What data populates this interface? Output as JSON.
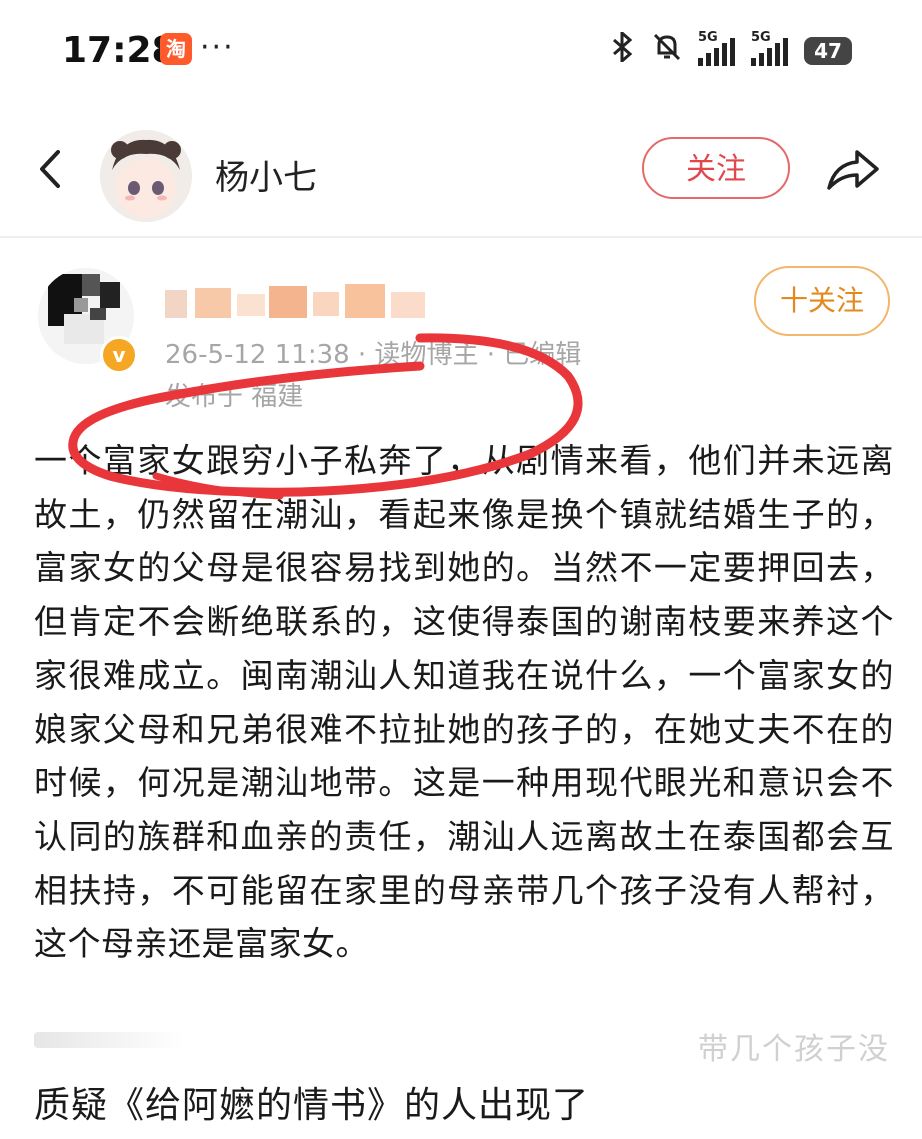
{
  "status_bar": {
    "time": "17:28",
    "app_badge": "淘",
    "more": "···",
    "network_1": "5G",
    "network_2": "5G",
    "battery": "47"
  },
  "header": {
    "author_name": "杨小七",
    "follow_label": "关注"
  },
  "post": {
    "meta": "26-5-12 11:38 · 读物博主 · 已编辑",
    "location": "发布于 福建",
    "follow_label": "十关注",
    "verified_badge": "v",
    "body": "一个富家女跟穷小子私奔了，从剧情来看，他们并未远离故土，仍然留在潮汕，看起来像是换个镇就结婚生子的，富家女的父母是很容易找到她的。当然不一定要押回去，但肯定不会断绝联系的，这使得泰国的谢南枝要来养这个家很难成立。闽南潮汕人知道我在说什么，一个富家女的娘家父母和兄弟很难不拉扯她的孩子的，在她丈夫不在的时候，何况是潮汕地带。这是一种用现代眼光和意识会不认同的族群和血亲的责任，潮汕人远离故土在泰国都会互相扶持，不可能留在家里的母亲带几个孩子没有人帮衬，这个母亲还是富家女。",
    "faded_text": "带几个孩子没"
  },
  "caption": "质疑《给阿嬷的情书》的人出现了",
  "colors": {
    "follow_red": "#e0484e",
    "follow_orange": "#e38a1e",
    "meta_gray": "#a6a6a6",
    "annotation_red": "#e8363a",
    "verified_orange": "#f5a623"
  }
}
